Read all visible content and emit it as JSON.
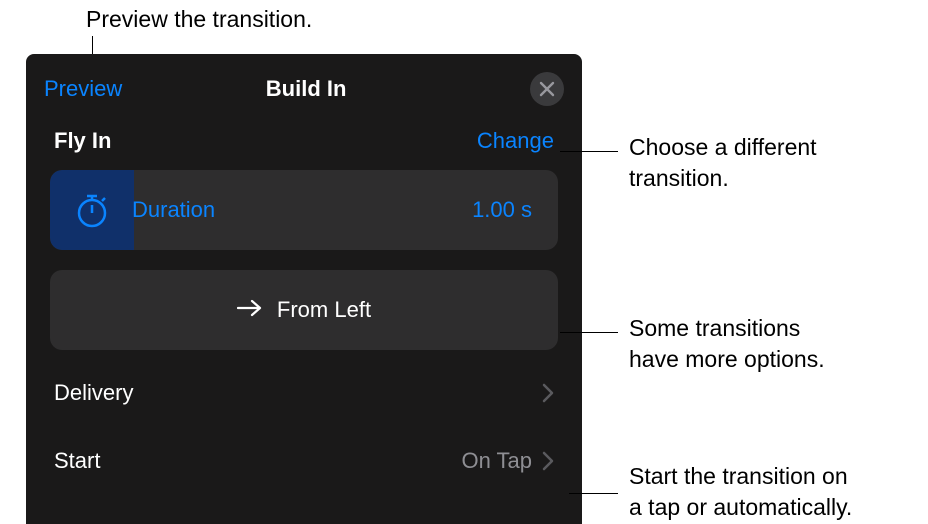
{
  "callouts": {
    "preview": "Preview the transition.",
    "change_l1": "Choose a different",
    "change_l2": "transition.",
    "direction_l1": "Some transitions",
    "direction_l2": "have more options.",
    "start_l1": "Start the transition on",
    "start_l2": "a tap or automatically."
  },
  "header": {
    "preview": "Preview",
    "title": "Build In"
  },
  "effect": {
    "name": "Fly In",
    "change": "Change"
  },
  "duration": {
    "label": "Duration",
    "value": "1.00 s"
  },
  "direction": {
    "label": "From Left"
  },
  "rows": {
    "delivery": {
      "label": "Delivery"
    },
    "start": {
      "label": "Start",
      "value": "On Tap"
    }
  }
}
